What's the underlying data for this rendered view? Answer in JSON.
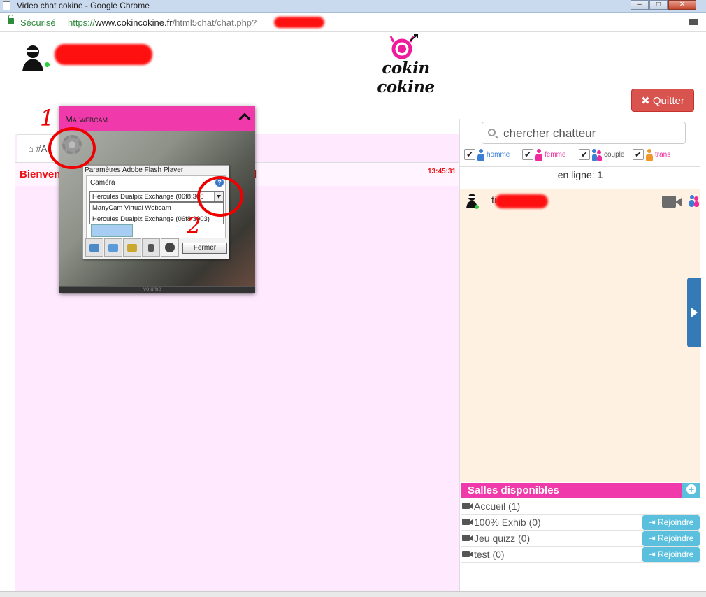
{
  "window": {
    "title": "Video chat cokine - Google Chrome",
    "minimize": "–",
    "maximize": "□",
    "close": "✕"
  },
  "address_bar": {
    "secure_label": "Sécurisé",
    "url_scheme": "https://",
    "url_host": "www.cokincokine.fr",
    "url_path": "/html5chat/chat.php?"
  },
  "header": {
    "logo_text": "cokin cokine",
    "quit_label": "✖ Quitter"
  },
  "chat": {
    "tab_label": "⌂ #Ac",
    "welcome_text": "Bienven",
    "welcome_end": "l",
    "timestamp": "13:45:31"
  },
  "webcam_panel": {
    "title": "Ma webcam",
    "footer_label": "volume"
  },
  "flash_settings": {
    "title": "Paramètres Adobe Flash Player",
    "camera_label": "Caméra",
    "selected_camera": "Hercules Dualpix Exchange (06f8:300",
    "options": [
      "ManyCam Virtual Webcam",
      "Hercules Dualpix Exchange (06f8:3003)"
    ],
    "help": "?",
    "close_label": "Fermer"
  },
  "annotations": {
    "one": "1",
    "two": "2"
  },
  "search": {
    "placeholder": "chercher chatteur"
  },
  "filters": [
    {
      "label": "homme",
      "checked": "✔",
      "color": "#3a7fd5"
    },
    {
      "label": "femme",
      "checked": "✔",
      "color": "#ee2a9c"
    },
    {
      "label": "couple",
      "checked": "✔",
      "color": "#3a7fd5"
    },
    {
      "label": "trans",
      "checked": "✔",
      "color": "#f0962a"
    }
  ],
  "online": {
    "label": "en ligne:",
    "count": "1"
  },
  "users": [
    {
      "name_visible": "ti"
    }
  ],
  "rooms": {
    "title": "Salles disponibles",
    "items": [
      {
        "name": "Accueil (1)",
        "join_label": ""
      },
      {
        "name": "100% Exhib (0)",
        "join_label": "⇥ Rejoindre"
      },
      {
        "name": "Jeu quizz (0)",
        "join_label": "⇥ Rejoindre"
      },
      {
        "name": "test (0)",
        "join_label": "⇥ Rejoindre"
      }
    ]
  },
  "colors": {
    "brand_pink": "#f03aab",
    "quit_red": "#d9534f",
    "join_blue": "#5bc0de",
    "toggle_blue": "#337ab7"
  }
}
